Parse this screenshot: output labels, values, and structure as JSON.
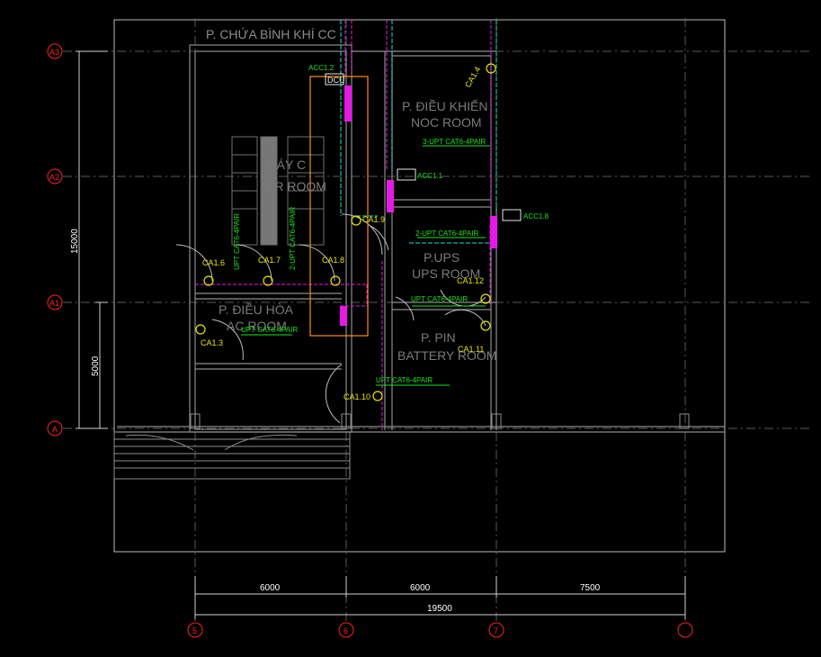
{
  "rooms": {
    "gas_room": "P. CHỨA BÌNH KHÍ CC",
    "control_vi": "P. ĐIỀU KHIỂN",
    "control_en": "NOC ROOM",
    "ups_vi": "P.UPS",
    "ups_en": "UPS ROOM",
    "battery_vi": "P. PIN",
    "battery_en": "BATTERY ROOM",
    "ac_vi": "P. ĐIỀU HÒA",
    "ac_en": "AC ROOM",
    "server_vi": "MÁY C",
    "server_en": "ER ROOM"
  },
  "devices": {
    "dcu": "DCU",
    "acc12": "ACC1.2",
    "acc11": "ACC1.1",
    "acc18": "ACC1.8",
    "ca14": "CA1.4",
    "ca16": "CA1.6",
    "ca17": "CA1.7",
    "ca18": "CA1.8",
    "ca19": "CA1.9",
    "ca13": "CA1.3",
    "ca110": "CA1.10",
    "ca111": "CA1.11",
    "ca112": "CA1.12"
  },
  "cables": {
    "c1": "3-UPT CAT6-4PAIR",
    "c2": "2-UPT CAT6-4PAIR",
    "c3": "UPT CAT6-4PAIR",
    "c4": "UPT CAT6-4PAIR",
    "c5": "UPT CAT6-4PAIR",
    "c6": "UPT CAT6-4PAIR",
    "c7": "2-UPT CAT6-4PAIR"
  },
  "grid_rows": [
    "A3",
    "A2",
    "A1",
    "A"
  ],
  "grid_cols": [
    "5",
    "6",
    "7",
    ""
  ],
  "dimensions": {
    "d1": "6000",
    "d2": "6000",
    "d3": "7500",
    "total": "19500",
    "v_total": "15000",
    "v_part": "5000"
  },
  "colors": {
    "wall": "#8c8c8c",
    "cable": "#19e619",
    "device": "#e6e600",
    "conduit": "#e619e6",
    "tray": "#ff8c1a",
    "grid_bubble": "#ff2020"
  }
}
